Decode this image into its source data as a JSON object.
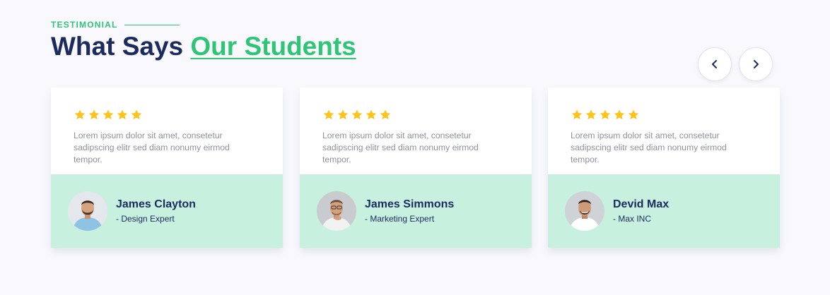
{
  "section": {
    "eyebrow": "TESTIMONIAL",
    "heading_prefix": "What Says",
    "heading_accent": "Our Students"
  },
  "nav": {
    "prev_icon": "chevron-left-icon",
    "next_icon": "chevron-right-icon"
  },
  "colors": {
    "accent": "#2ec577",
    "heading": "#1c2b5e",
    "star": "#fcc419",
    "card_footer": "#c8f0de"
  },
  "testimonials": [
    {
      "rating": 5,
      "quote": "Lorem ipsum dolor sit amet, consetetur sadipscing elitr sed diam nonumy eirmod tempor.",
      "name": "James Clayton",
      "role": "- Design Expert"
    },
    {
      "rating": 5,
      "quote": "Lorem ipsum dolor sit amet, consetetur sadipscing elitr sed diam nonumy eirmod tempor.",
      "name": "James Simmons",
      "role": "- Marketing Expert"
    },
    {
      "rating": 5,
      "quote": "Lorem ipsum dolor sit amet, consetetur sadipscing elitr sed diam nonumy eirmod tempor.",
      "name": "Devid Max",
      "role": "- Max INC"
    }
  ]
}
